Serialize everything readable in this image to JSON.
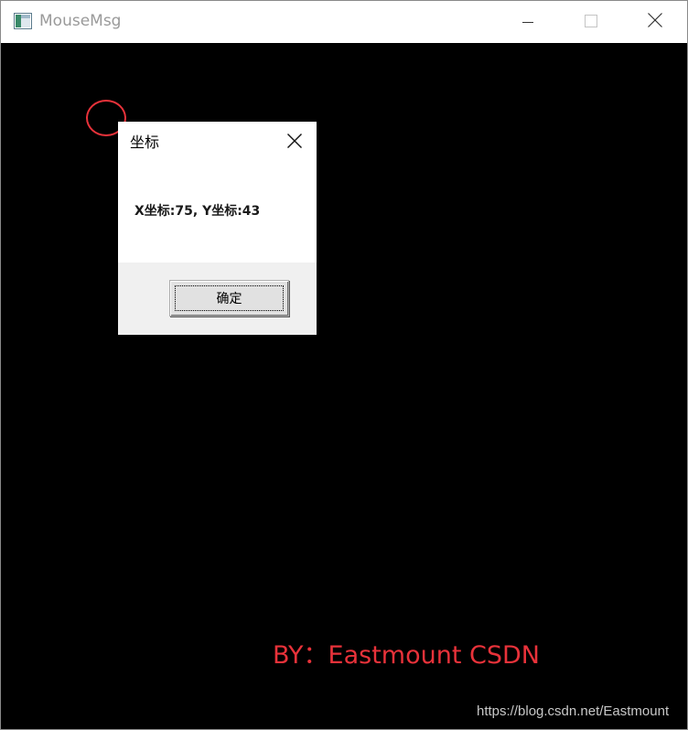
{
  "window": {
    "title": "MouseMsg",
    "icon": "app-window-icon",
    "buttons": {
      "minimize": "minimize-icon",
      "maximize": "maximize-icon",
      "close": "close-icon"
    }
  },
  "canvas": {
    "background": "#000000",
    "marker_color": "#e8323a"
  },
  "dialog": {
    "title": "坐标",
    "message": "X坐标:75, Y坐标:43",
    "ok_label": "确定",
    "close_icon": "close-icon"
  },
  "overlay": {
    "byline": "BY：Eastmount CSDN",
    "byline_color": "#e8323a",
    "watermark": "https://blog.csdn.net/Eastmount"
  }
}
